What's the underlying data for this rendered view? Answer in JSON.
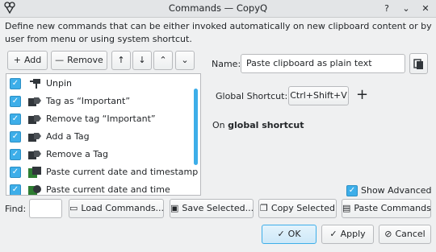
{
  "window": {
    "title": "Commands — CopyQ",
    "help_glyph": "?",
    "minimize_glyph": "⌄",
    "close_glyph": "✕"
  },
  "description": "Define new commands that can be either invoked automatically on new clipboard content or by user from menu or using system shortcut.",
  "list_toolbar": {
    "add_label": "Add",
    "remove_label": "Remove",
    "add_glyph": "+",
    "remove_glyph": "—",
    "move_up_glyph": "↑",
    "move_down_glyph": "↓",
    "move_top_glyph": "⌃",
    "move_bottom_glyph": "⌄"
  },
  "commands": [
    {
      "label": "Unpin",
      "checked": true,
      "icon": "pin-icon"
    },
    {
      "label": "Tag as “Important”",
      "checked": true,
      "icon": "tag-icon"
    },
    {
      "label": "Remove tag “Important”",
      "checked": true,
      "icon": "tag-icon"
    },
    {
      "label": "Add a Tag",
      "checked": true,
      "icon": "tag-icon"
    },
    {
      "label": "Remove a Tag",
      "checked": true,
      "icon": "tag-icon"
    },
    {
      "label": "Paste current date and timestamp",
      "checked": true,
      "icon": "paste-date-icon"
    },
    {
      "label": "Paste current date and time",
      "checked": true,
      "icon": "clock-icon"
    }
  ],
  "detail": {
    "name_label": "Name:",
    "name_value": "Paste clipboard as plain text",
    "global_shortcut_label": "Global Shortcut:",
    "shortcut_value": "Ctrl+Shift+V",
    "add_shortcut_glyph": "+",
    "trigger_prefix": "On ",
    "trigger_bold": "global shortcut",
    "show_advanced_label": "Show Advanced",
    "show_advanced_checked": true
  },
  "bottom": {
    "find_label": "Find:",
    "find_value": "",
    "load_label": "Load Commands...",
    "save_label": "Save Selected...",
    "copy_label": "Copy Selected",
    "paste_label": "Paste Commands"
  },
  "dialog_buttons": {
    "ok_label": "OK",
    "apply_label": "Apply",
    "cancel_label": "Cancel"
  },
  "colors": {
    "accent": "#3daee9",
    "window_bg": "#eff0f1"
  }
}
